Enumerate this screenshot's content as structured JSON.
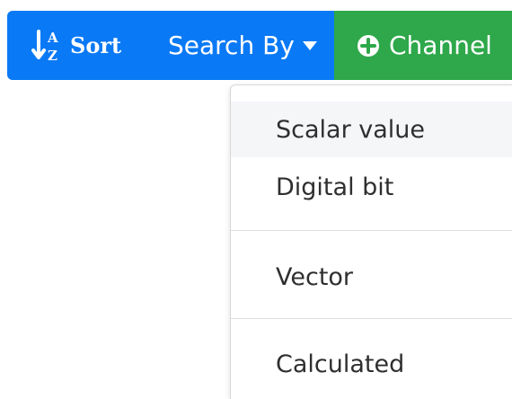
{
  "toolbar": {
    "sort": {
      "label": "Sort",
      "icon": "sort-alpha-icon"
    },
    "search": {
      "label": "Search By",
      "icon": "caret-down-icon"
    },
    "channel": {
      "label": "Channel",
      "icon": "plus-circle-icon"
    },
    "colors": {
      "primary": "#0a79f5",
      "success": "#2ea84a"
    }
  },
  "dropdown": {
    "items": [
      {
        "label": "Scalar value"
      },
      {
        "label": "Digital bit"
      },
      {
        "label": "Vector"
      },
      {
        "label": "Calculated"
      }
    ],
    "colors": {
      "hover_background": "#f4f6f8",
      "text": "#2f2f2f",
      "divider": "#dfdfdf"
    }
  }
}
